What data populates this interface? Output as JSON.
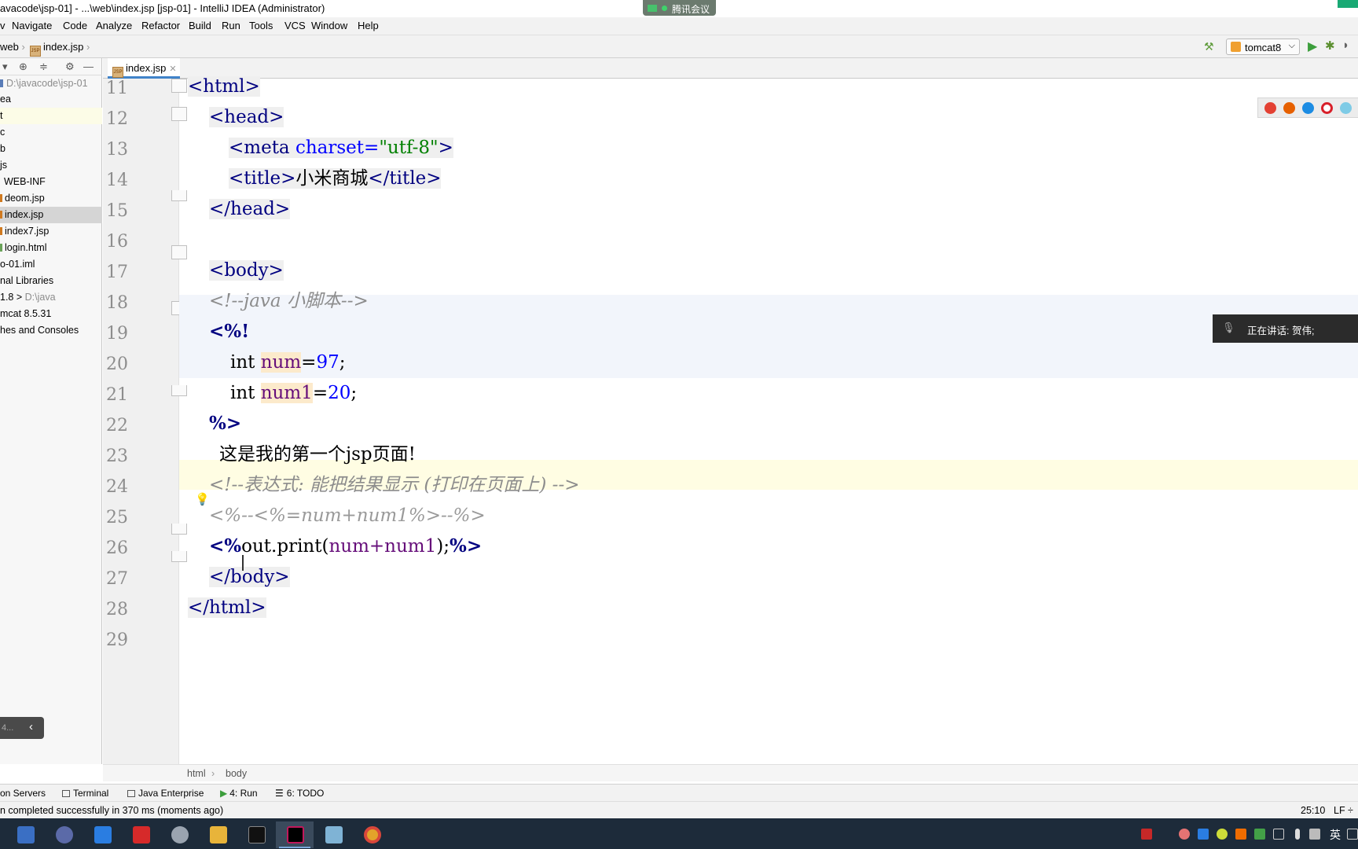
{
  "window": {
    "title": "avacode\\jsp-01] - ...\\web\\index.jsp [jsp-01] - IntelliJ IDEA (Administrator)",
    "meeting_label": "腾讯会议"
  },
  "menu": [
    "v",
    "Navigate",
    "Code",
    "Analyze",
    "Refactor",
    "Build",
    "Run",
    "Tools",
    "VCS",
    "Window",
    "Help"
  ],
  "nav": {
    "crumb1": "web",
    "crumb2": "index.jsp",
    "run_config": "tomcat8"
  },
  "project_tree": {
    "root_label": "D:\\javacode\\jsp-01",
    "items": [
      "ea",
      "t",
      "c",
      "b",
      "js",
      "WEB-INF",
      "deom.jsp",
      "index.jsp",
      "index7.jsp",
      "login.html",
      "o-01.iml",
      "nal Libraries",
      "1.8 >",
      "mcat 8.5.31",
      "hes and Consoles"
    ],
    "jdk_path": "D:\\java",
    "mini_label": "4..."
  },
  "editor_tab": "index.jsp",
  "code": {
    "line_numbers": [
      "11",
      "12",
      "13",
      "14",
      "15",
      "16",
      "17",
      "18",
      "19",
      "20",
      "21",
      "22",
      "23",
      "24",
      "25",
      "26",
      "27",
      "28",
      "29"
    ],
    "l11": "<html>",
    "l12": "<head>",
    "l13_open": "<meta ",
    "l13_attr": "charset=",
    "l13_val": "\"utf-8\"",
    "l13_close": ">",
    "l14_open": "<title>",
    "l14_text": "小米商城",
    "l14_close": "</title>",
    "l15": "</head>",
    "l17": "<body>",
    "l18": "<!--java 小脚本-->",
    "l19": "<%!",
    "l20_kw": "int ",
    "l20_var": "num",
    "l20_eq": "=",
    "l20_num": "97",
    "l20_end": ";",
    "l21_kw": "int ",
    "l21_var": "num1",
    "l21_eq": "=",
    "l21_num": "20",
    "l21_end": ";",
    "l22": "%>",
    "l23": "这是我的第一个jsp页面!",
    "l24": "<!--表达式: 能把结果显示 (打印在页面上) -->",
    "l25": "<%--<%=num+num1%>--%>",
    "l26_open": "<%",
    "l26_code": "out.print(",
    "l26_var": "num+num1",
    "l26_after": ");",
    "l26_close": "%>",
    "l27": "</body>",
    "l28": "</html>"
  },
  "speaking": "正在讲话: 贺伟;",
  "editor_breadcrumb": [
    "html",
    "body"
  ],
  "tool_windows": [
    "on Servers",
    "Terminal",
    "Java Enterprise",
    "4: Run",
    "6: TODO"
  ],
  "status": {
    "message": "n completed successfully in 370 ms (moments ago)",
    "position": "25:10",
    "line_sep": "LF ÷"
  },
  "taskbar": {
    "lang": "英"
  }
}
